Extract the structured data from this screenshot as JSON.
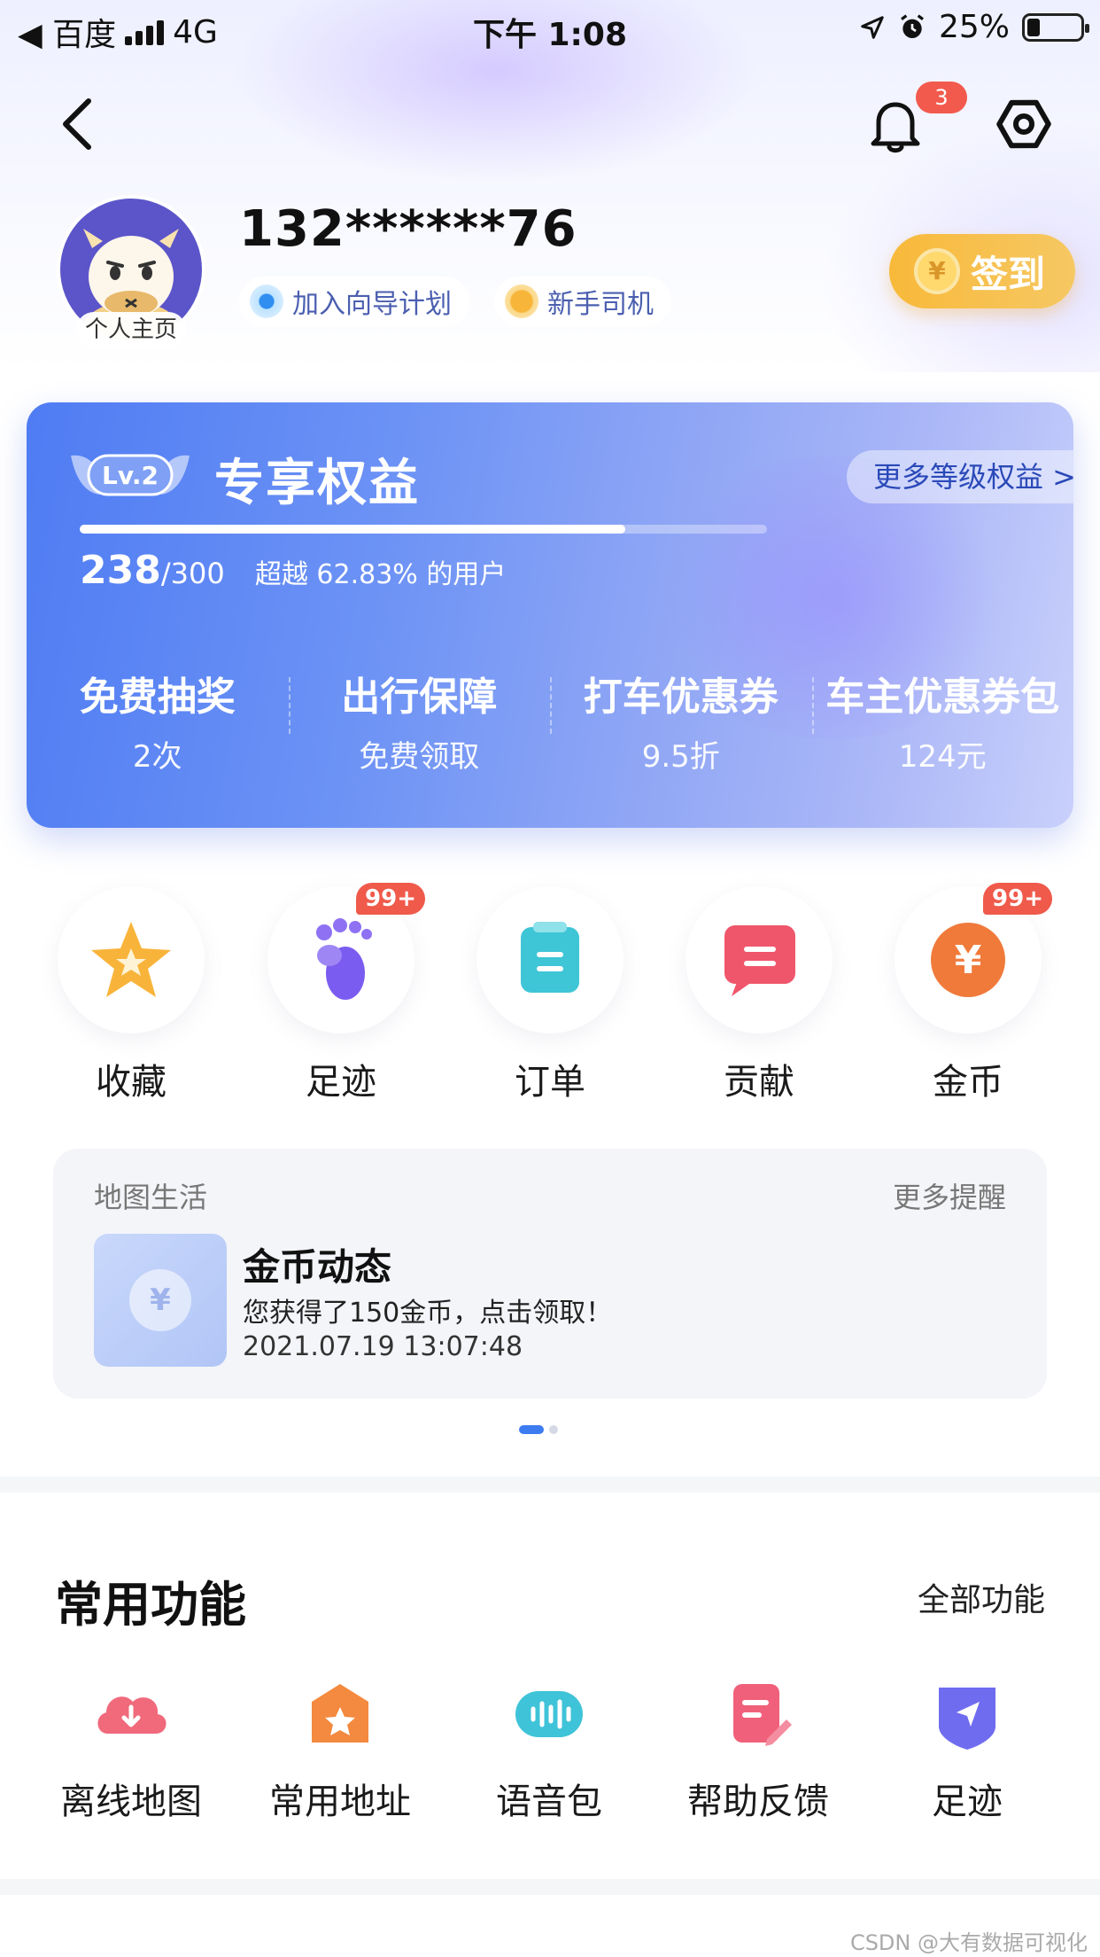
{
  "status_bar": {
    "carrier": "◀ 百度",
    "network": "4G",
    "time": "下午 1:08",
    "battery": "25%"
  },
  "nav": {
    "notification_count": "3"
  },
  "profile": {
    "phone": "132******76",
    "avatar_label": "个人主页",
    "chips": [
      {
        "label": "加入向导计划"
      },
      {
        "label": "新手司机"
      }
    ],
    "checkin_coin": "¥",
    "checkin_label": "签到"
  },
  "benefits_card": {
    "level": "Lv.2",
    "title": "专享权益",
    "more_link": "更多等级权益 >",
    "score_current": "238",
    "score_total": "/300",
    "progress_fraction": 0.7933,
    "beyond_text": "超越 62.83% 的用户",
    "items": [
      {
        "title": "免费抽奖",
        "sub": "2次"
      },
      {
        "title": "出行保障",
        "sub": "免费领取"
      },
      {
        "title": "打车优惠券",
        "sub": "9.5折"
      },
      {
        "title": "车主优惠券包",
        "sub": "124元"
      }
    ]
  },
  "quick_actions": [
    {
      "label": "收藏",
      "icon": "star-icon",
      "badge": ""
    },
    {
      "label": "足迹",
      "icon": "footprint-icon",
      "badge": "99+"
    },
    {
      "label": "订单",
      "icon": "order-icon",
      "badge": ""
    },
    {
      "label": "贡献",
      "icon": "contribution-icon",
      "badge": ""
    },
    {
      "label": "金币",
      "icon": "coin-icon",
      "badge": "99+"
    }
  ],
  "map_life": {
    "header": "地图生活",
    "more": "更多提醒",
    "thumb_symbol": "¥",
    "title": "金币动态",
    "message": "您获得了150金币，点击领取！",
    "time": "2021.07.19 13:07:48"
  },
  "common_functions": {
    "title": "常用功能",
    "more": "全部功能",
    "items": [
      {
        "label": "离线地图",
        "icon": "offline-map-icon"
      },
      {
        "label": "常用地址",
        "icon": "favorite-address-icon"
      },
      {
        "label": "语音包",
        "icon": "voice-pack-icon"
      },
      {
        "label": "帮助反馈",
        "icon": "feedback-icon"
      },
      {
        "label": "足迹",
        "icon": "footprint-shield-icon"
      }
    ]
  },
  "watermark": "CSDN @大有数据可视化",
  "colors": {
    "accent_blue": "#4f7cf3",
    "checkin_orange": "#f8b93a",
    "badge_red": "#ef5a4b"
  }
}
